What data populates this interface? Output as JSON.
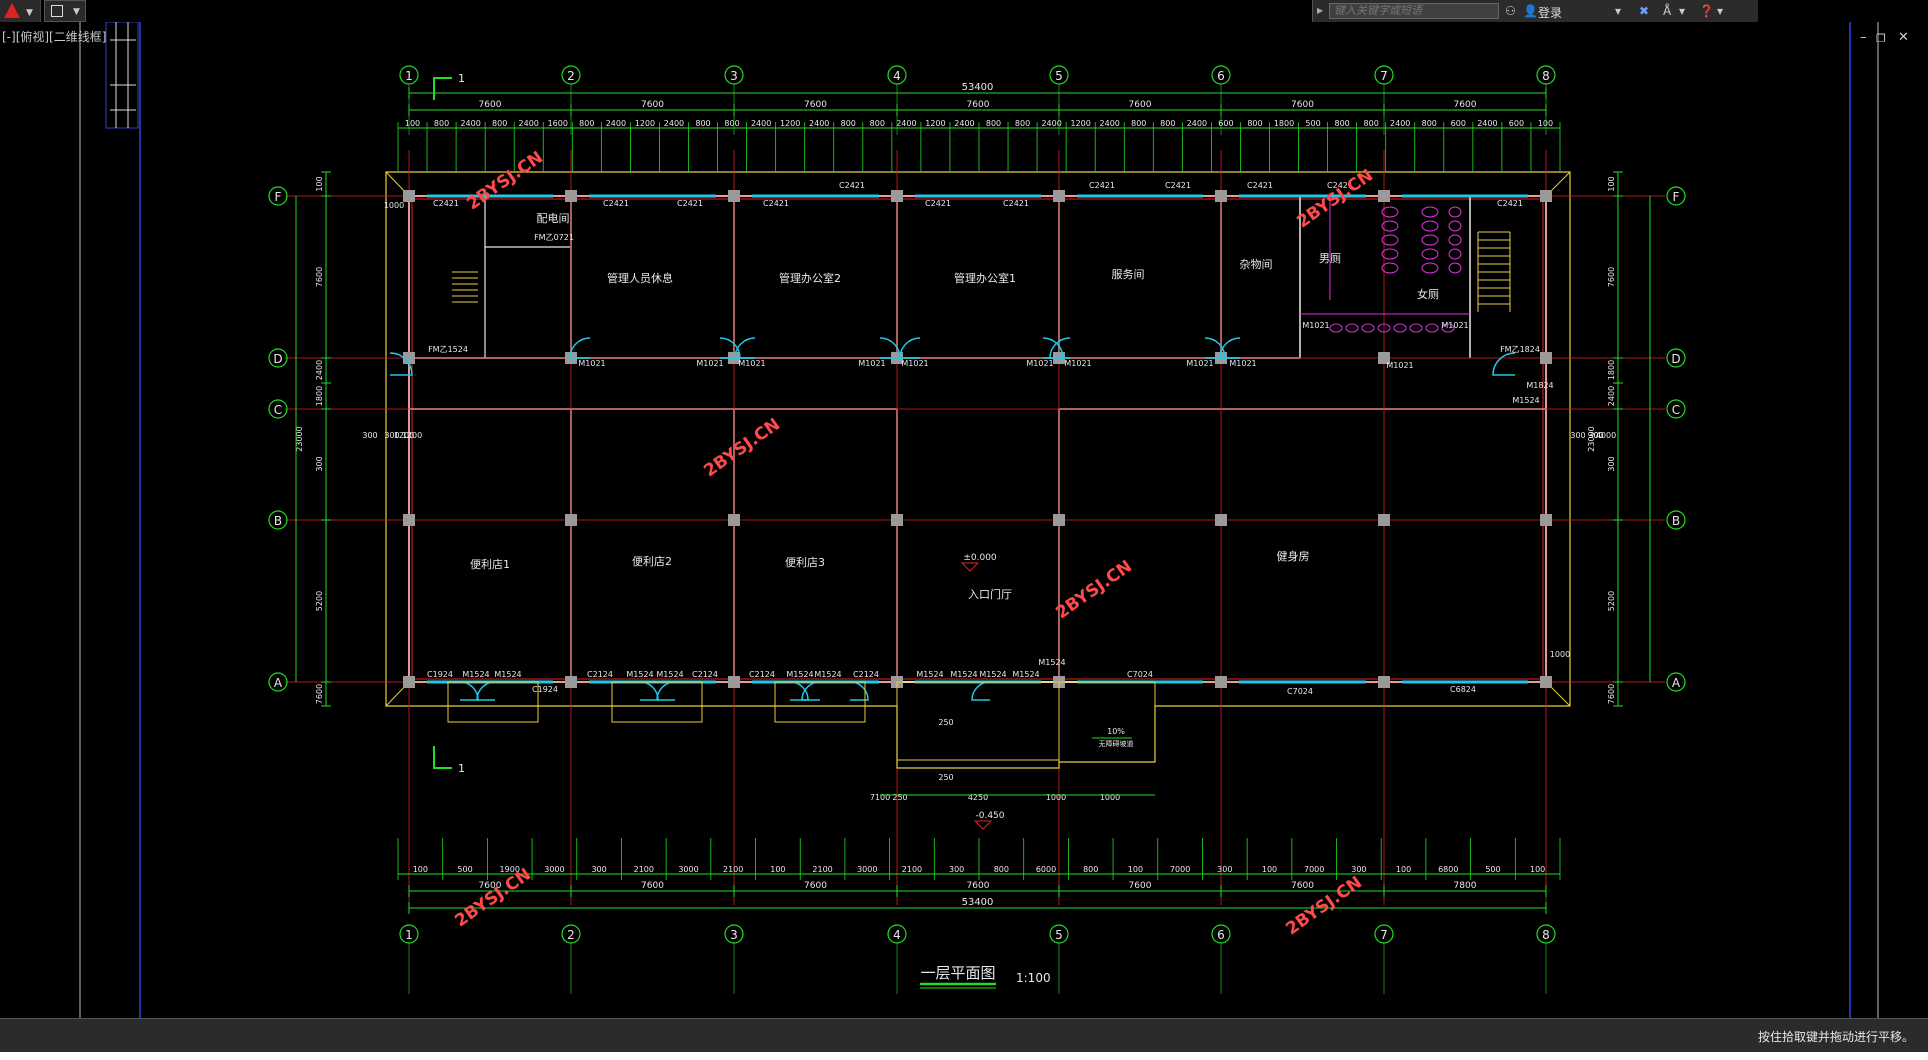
{
  "app": {
    "brand_color": "#d22222"
  },
  "view_label": "[-][俯视][二维线框]",
  "info_center": {
    "search_placeholder": "键入关键字或短语",
    "login_label": "登录"
  },
  "window_controls": {
    "minimize": "–",
    "restore": "❐",
    "close": "✕"
  },
  "status_message": "按住拾取键并拖动进行平移。",
  "drawing": {
    "title": "一层平面图",
    "scale": "1:100",
    "watermark": "2BYSJ.CN",
    "section_mark": "1",
    "axes_x": [
      "1",
      "2",
      "3",
      "4",
      "5",
      "6",
      "7",
      "8"
    ],
    "axes_y": [
      "F",
      "D",
      "C",
      "B",
      "A"
    ],
    "total_dim": "53400",
    "bay_dims": [
      "7600",
      "7600",
      "7600",
      "7600",
      "7600",
      "7600",
      "7600"
    ],
    "bay_dims_bottom": [
      "7600",
      "7600",
      "7600",
      "7600",
      "7600",
      "7600",
      "7800"
    ],
    "top_detail_dims": [
      "100",
      "800",
      "2400",
      "800",
      "2400",
      "1600",
      "800",
      "2400",
      "1200",
      "2400",
      "800",
      "800",
      "2400",
      "1200",
      "2400",
      "800",
      "800",
      "2400",
      "1200",
      "2400",
      "800",
      "800",
      "2400",
      "1200",
      "2400",
      "800",
      "800",
      "2400",
      "600",
      "800",
      "1800",
      "500",
      "800",
      "800",
      "2400",
      "800",
      "600",
      "2400",
      "600",
      "100"
    ],
    "bottom_detail_dims": [
      "100",
      "500",
      "1900",
      "3000",
      "300",
      "2100",
      "3000",
      "2100",
      "100",
      "2100",
      "3000",
      "2100",
      "300",
      "800",
      "6000",
      "800",
      "100",
      "7000",
      "300",
      "100",
      "7000",
      "300",
      "100",
      "6800",
      "500",
      "100"
    ],
    "left_dims": [
      "100",
      "7600",
      "2400",
      "1800",
      "300",
      "5200",
      "7600",
      "100",
      "23000"
    ],
    "right_dims": [
      "100",
      "7600",
      "1800",
      "2400",
      "300",
      "5200",
      "7600",
      "100",
      "23000"
    ],
    "rooms": [
      "配电间",
      "管理人员休息",
      "管理办公室2",
      "管理办公室1",
      "服务间",
      "杂物间",
      "男厕",
      "女厕",
      "便利店1",
      "便利店2",
      "便利店3",
      "入口门厅",
      "健身房"
    ],
    "door_labels": [
      "FM乙1524",
      "FM乙0721",
      "M1021",
      "M1021",
      "M1021",
      "M1021",
      "M1021",
      "M1021",
      "M1021",
      "M1021",
      "M1021",
      "M1021",
      "M1021",
      "M1021",
      "FM乙1824",
      "M1824",
      "M1524",
      "M1524",
      "M1524",
      "M1524",
      "M1524",
      "M1524",
      "M1524",
      "M1524",
      "M1524",
      "M1524",
      "M1524",
      "M1524"
    ],
    "window_labels": [
      "C2421",
      "C2421",
      "C2421",
      "C2421",
      "C2421",
      "C2421",
      "C2421",
      "C2421",
      "C2421",
      "C2421",
      "C2421",
      "C1924",
      "C1924",
      "C2124",
      "C2124",
      "C2124",
      "C2124",
      "C7024",
      "C7024",
      "C6824",
      "C2421"
    ],
    "elevations": [
      "±0.000",
      "-0.450"
    ],
    "ramp_label": "10%",
    "ramp_note": "无障碍坡道",
    "small_dims": [
      "1000",
      "1000",
      "300",
      "300",
      "1200",
      "1200",
      "300",
      "300",
      "4000",
      "300",
      "250",
      "250",
      "7100",
      "250",
      "4250",
      "1000",
      "1000"
    ]
  }
}
